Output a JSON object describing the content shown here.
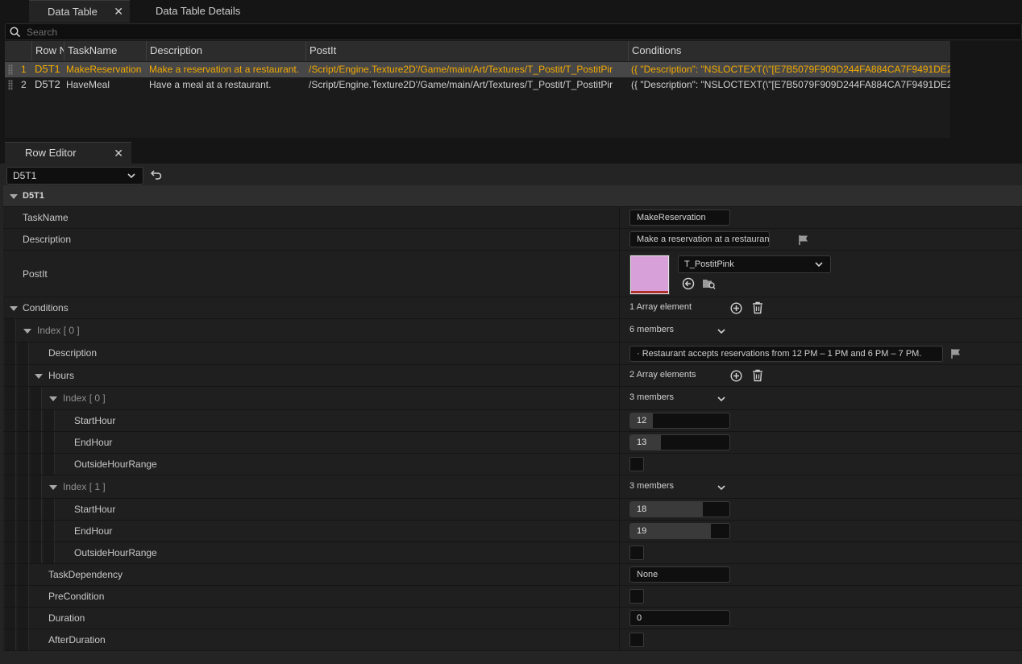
{
  "tabs": [
    {
      "label": "Data Table",
      "active": true
    },
    {
      "label": "Data Table Details",
      "active": false
    }
  ],
  "search": {
    "placeholder": "Search"
  },
  "table": {
    "columns": [
      "Row N",
      "TaskName",
      "Description",
      "PostIt",
      "Conditions"
    ],
    "rows": [
      {
        "index": "1",
        "row_name": "D5T1",
        "task_name": "MakeReservation",
        "description": "Make a reservation at a restaurant.",
        "postit": "/Script/Engine.Texture2D'/Game/main/Art/Textures/T_Postit/T_PostitPir",
        "conditions": "({ \"Description\": \"NSLOCTEXT(\\\"[E7B5079F909D244FA884CA7F9491DE2",
        "selected": true
      },
      {
        "index": "2",
        "row_name": "D5T2",
        "task_name": "HaveMeal",
        "description": "Have a meal at a restaurant.",
        "postit": "/Script/Engine.Texture2D'/Game/main/Art/Textures/T_Postit/T_PostitPir",
        "conditions": "({ \"Description\": \"NSLOCTEXT(\\\"[E7B5079F909D244FA884CA7F9491DE2",
        "selected": false
      }
    ]
  },
  "row_editor": {
    "tab_label": "Row Editor",
    "selected_row": "D5T1",
    "category": "D5T1",
    "task_name_label": "TaskName",
    "task_name_value": "MakeReservation",
    "description_label": "Description",
    "description_value": "Make a reservation at a restaurant.",
    "postit_label": "PostIt",
    "postit_asset": "T_PostitPink",
    "postit_color": "#d8a0d8",
    "conditions_label": "Conditions",
    "conditions_count": "1 Array element",
    "cond_index0_label": "Index [ 0 ]",
    "cond_index0_members": "6 members",
    "cond_description_label": "Description",
    "cond_description_value": "· Restaurant accepts reservations from 12 PM – 1 PM and 6 PM – 7 PM.",
    "hours_label": "Hours",
    "hours_count": "2 Array elements",
    "hours": [
      {
        "label": "Index [ 0 ]",
        "members": "3 members",
        "start_label": "StartHour",
        "start": "12",
        "start_fill": 0.23,
        "end_label": "EndHour",
        "end": "13",
        "end_fill": 0.31,
        "outside_label": "OutsideHourRange",
        "outside": false
      },
      {
        "label": "Index [ 1 ]",
        "members": "3 members",
        "start_label": "StartHour",
        "start": "18",
        "start_fill": 0.73,
        "end_label": "EndHour",
        "end": "19",
        "end_fill": 0.81,
        "outside_label": "OutsideHourRange",
        "outside": false
      }
    ],
    "task_dependency_label": "TaskDependency",
    "task_dependency_value": "None",
    "precondition_label": "PreCondition",
    "precondition": false,
    "duration_label": "Duration",
    "duration_value": "0",
    "after_duration_label": "AfterDuration",
    "after_duration": false
  },
  "icons": {
    "search": "search-icon",
    "close": "close-icon",
    "chevron": "chevron-down-icon",
    "undo": "undo-icon",
    "flag": "localization-flag-icon",
    "add": "add-element-icon",
    "delete": "delete-icon",
    "use_selected": "use-selected-asset-icon",
    "browse": "browse-asset-icon"
  },
  "colors": {
    "selected_row_text": "#f2a900",
    "postit_swatch": "#d8a0d8"
  }
}
